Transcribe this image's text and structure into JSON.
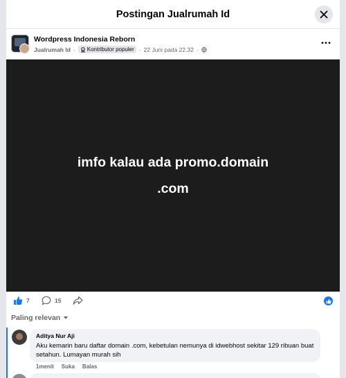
{
  "dialog": {
    "title": "Postingan Jualrumah Id"
  },
  "post": {
    "page_name": "Wordpress Indonesia Reborn",
    "author": "Jualrumah Id",
    "badge_label": "Kontributor populer",
    "timestamp": "22 Juni pada 22.32",
    "separator": "·",
    "media_lines": [
      "imfo kalau ada promo.domain",
      ".com"
    ]
  },
  "actions": {
    "likes": "7",
    "comments": "15"
  },
  "sort": {
    "label": "Paling relevan"
  },
  "comment": {
    "author": "Aditya Nur Aji",
    "text": "Aku kemarin baru daftar domain .com, kebetulan nemunya di idwebhost sekitar 129 ribuan buat setahun. Lumayan murah sih",
    "time": "1menit",
    "like_label": "Suka",
    "reply_label": "Balas"
  },
  "colors": {
    "accent": "#1877f2",
    "media_bg": "#1c1c1c",
    "secondary_text": "#65676b"
  }
}
